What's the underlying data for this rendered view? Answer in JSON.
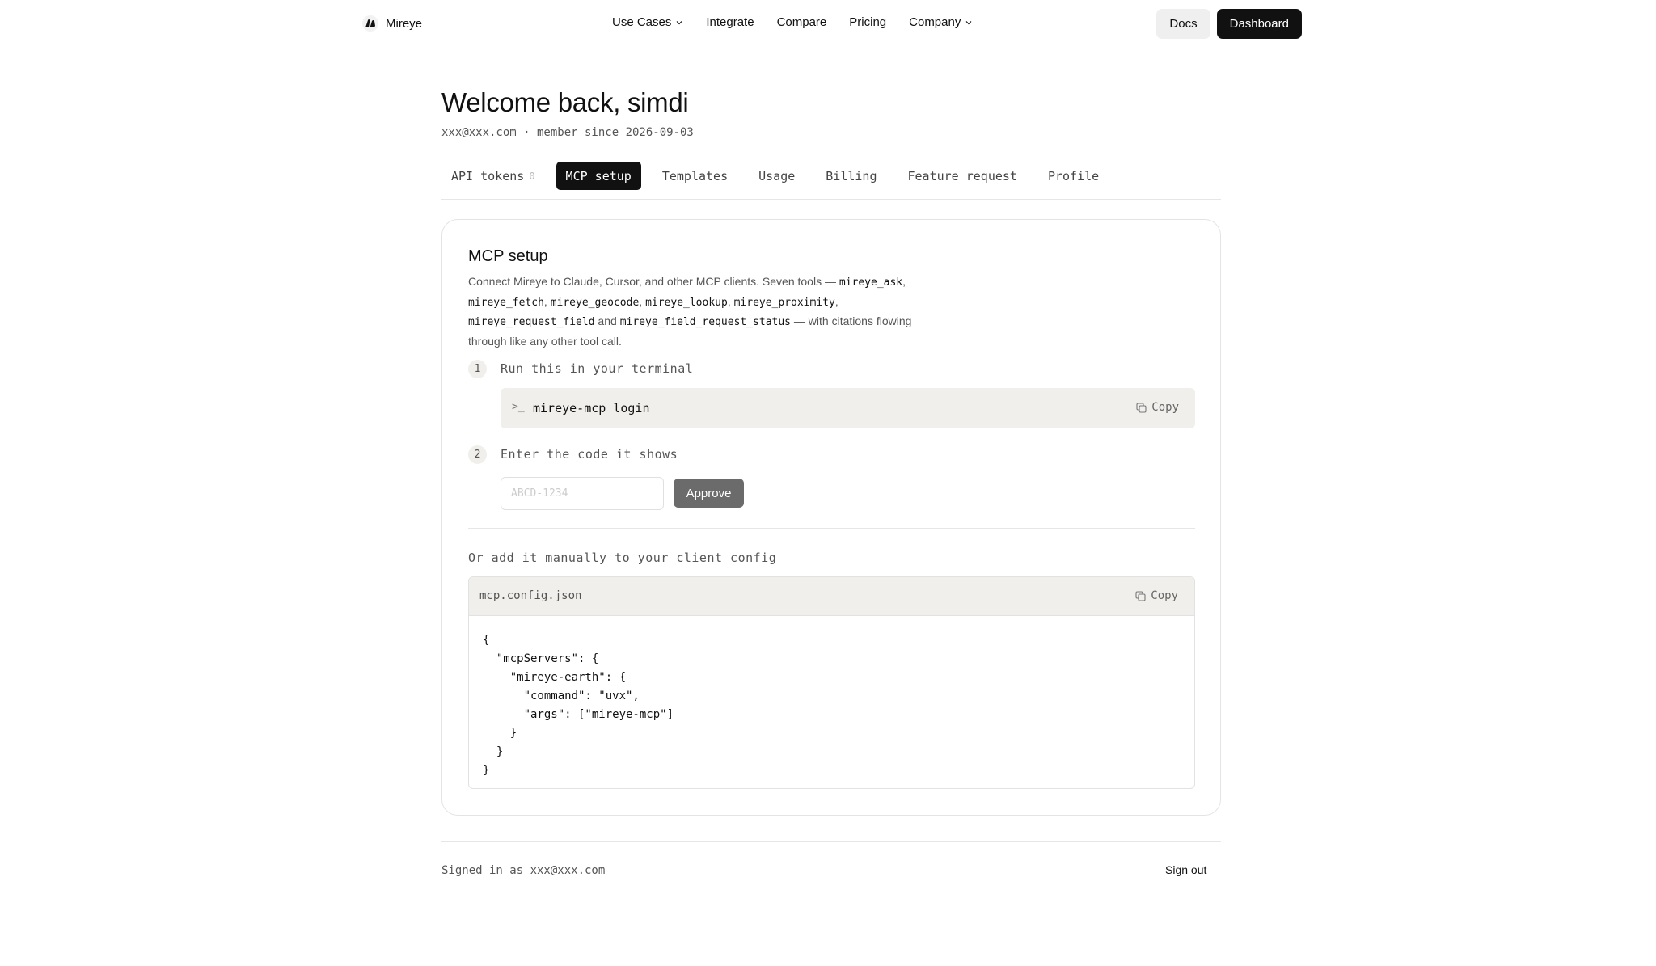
{
  "brand": {
    "name": "Mireye"
  },
  "nav": {
    "items": [
      {
        "label": "Use Cases",
        "dropdown": true
      },
      {
        "label": "Integrate",
        "dropdown": false
      },
      {
        "label": "Compare",
        "dropdown": false
      },
      {
        "label": "Pricing",
        "dropdown": false
      },
      {
        "label": "Company",
        "dropdown": true
      }
    ],
    "docs_label": "Docs",
    "dashboard_label": "Dashboard"
  },
  "header": {
    "title": "Welcome back, simdi",
    "subline": "xxx@xxx.com · member since 2026-09-03"
  },
  "tabs": {
    "items": [
      {
        "label": "API tokens",
        "count": "0"
      },
      {
        "label": "MCP setup",
        "active": true
      },
      {
        "label": "Templates"
      },
      {
        "label": "Usage"
      },
      {
        "label": "Billing"
      },
      {
        "label": "Feature request"
      },
      {
        "label": "Profile"
      }
    ]
  },
  "card": {
    "title": "MCP setup",
    "desc_intro": "Connect Mireye to Claude, Cursor, and other MCP clients. Seven tools — ",
    "tools": [
      "mireye_ask",
      "mireye_fetch",
      "mireye_geocode",
      "mireye_lookup",
      "mireye_proximity",
      "mireye_request_field",
      "mireye_field_request_status"
    ],
    "desc_and": " and ",
    "desc_outro": " — with citations flowing through like any other tool call.",
    "step1": {
      "num": "1",
      "label": "Run this in your terminal",
      "command": "mireye-mcp login",
      "prompt_glyph": ">_"
    },
    "step2": {
      "num": "2",
      "label": "Enter the code it shows",
      "placeholder": "ABCD-1234",
      "value": "",
      "approve_label": "Approve"
    },
    "copy_label": "Copy",
    "manual_label": "Or add it manually to your client config",
    "config": {
      "filename": "mcp.config.json",
      "content": "{\n  \"mcpServers\": {\n    \"mireye-earth\": {\n      \"command\": \"uvx\",\n      \"args\": [\"mireye-mcp\"]\n    }\n  }\n}"
    }
  },
  "footer": {
    "signed_in": "Signed in as xxx@xxx.com",
    "signout_label": "Sign out"
  },
  "colors": {
    "accent_dark": "#111111",
    "code_bg": "#f0efeb",
    "approve_bg": "#6b6b6b"
  }
}
